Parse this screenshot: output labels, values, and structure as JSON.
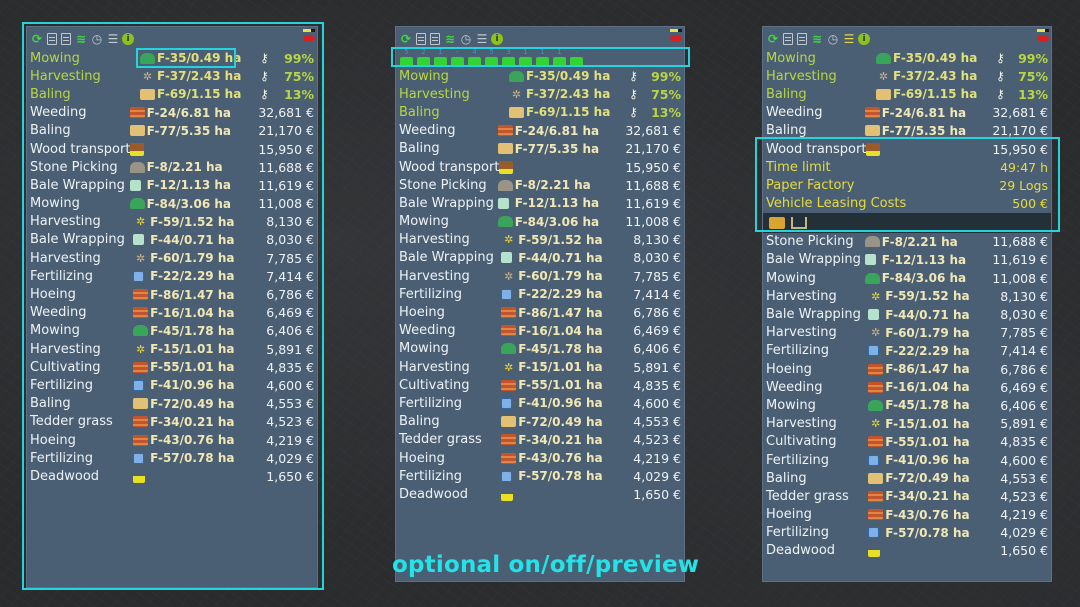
{
  "caption": "optional on/off/preview",
  "toolbar_icons": [
    "refresh-icon",
    "list-icon",
    "contract-icon",
    "field-icon",
    "clock-icon",
    "clear-filter-icon",
    "info-icon"
  ],
  "toolbar_right_icons": [
    "progress-bar-icon",
    "eye-icon"
  ],
  "colors": {
    "highlight": "#24d3dc",
    "active_text": "#b8d640",
    "detail_text": "#e7db3c",
    "panel_bg": "#4b5f74"
  },
  "vehicle_filter": [
    {
      "icon": "tractor-icon",
      "count": "5"
    },
    {
      "icon": "loader-icon",
      "count": "2"
    },
    {
      "icon": "trailer-icon",
      "count": "1"
    },
    {
      "icon": "harvester-icon",
      "count": "-"
    },
    {
      "icon": "mower-icon",
      "count": "4"
    },
    {
      "icon": "sprayer-icon",
      "count": "5"
    },
    {
      "icon": "cultivator-icon",
      "count": "3"
    },
    {
      "icon": "baler-icon",
      "count": "1"
    },
    {
      "icon": "chainsaw-icon",
      "count": "1"
    },
    {
      "icon": "weeder-icon",
      "count": "1"
    },
    {
      "icon": "seeder-icon",
      "count": "-"
    }
  ],
  "active_jobs": [
    {
      "name": "Mowing",
      "icon": "mowing-icon",
      "field": "F-35/0.49 ha",
      "progress": "99%"
    },
    {
      "name": "Harvesting",
      "icon": "harvesting-icon",
      "field": "F-37/2.43 ha",
      "progress": "75%"
    },
    {
      "name": "Baling",
      "icon": "baling-icon",
      "field": "F-69/1.15 ha",
      "progress": "13%"
    }
  ],
  "jobs": [
    {
      "name": "Weeding",
      "icon": "weeding-icon",
      "field": "F-24/6.81 ha",
      "reward": "32,681 €"
    },
    {
      "name": "Baling",
      "icon": "baling-icon",
      "field": "F-77/5.35 ha",
      "reward": "21,170 €"
    },
    {
      "name": "Wood transport",
      "icon": "wood-icon",
      "field": "",
      "reward": "15,950 €"
    },
    {
      "name": "Stone Picking",
      "icon": "stone-icon",
      "field": "F-8/2.21 ha",
      "reward": "11,688 €"
    },
    {
      "name": "Bale Wrapping",
      "icon": "wrap-icon",
      "field": "F-12/1.13 ha",
      "reward": "11,619 €"
    },
    {
      "name": "Mowing",
      "icon": "mowing-icon",
      "field": "F-84/3.06 ha",
      "reward": "11,008 €"
    },
    {
      "name": "Harvesting",
      "icon": "harvesting-yellow-icon",
      "field": "F-59/1.52 ha",
      "reward": "8,130 €"
    },
    {
      "name": "Bale Wrapping",
      "icon": "wrap-icon",
      "field": "F-44/0.71 ha",
      "reward": "8,030 €"
    },
    {
      "name": "Harvesting",
      "icon": "harvesting-icon",
      "field": "F-60/1.79 ha",
      "reward": "7,785 €"
    },
    {
      "name": "Fertilizing",
      "icon": "fertilizing-icon",
      "field": "F-22/2.29 ha",
      "reward": "7,414 €"
    },
    {
      "name": "Hoeing",
      "icon": "hoeing-icon",
      "field": "F-86/1.47 ha",
      "reward": "6,786 €"
    },
    {
      "name": "Weeding",
      "icon": "weeding-icon",
      "field": "F-16/1.04 ha",
      "reward": "6,469 €"
    },
    {
      "name": "Mowing",
      "icon": "mowing-icon",
      "field": "F-45/1.78 ha",
      "reward": "6,406 €"
    },
    {
      "name": "Harvesting",
      "icon": "harvesting-yellow-icon",
      "field": "F-15/1.01 ha",
      "reward": "5,891 €"
    },
    {
      "name": "Cultivating",
      "icon": "cultivating-icon",
      "field": "F-55/1.01 ha",
      "reward": "4,835 €"
    },
    {
      "name": "Fertilizing",
      "icon": "fertilizing-icon",
      "field": "F-41/0.96 ha",
      "reward": "4,600 €"
    },
    {
      "name": "Baling",
      "icon": "baling-icon",
      "field": "F-72/0.49 ha",
      "reward": "4,553 €"
    },
    {
      "name": "Tedder grass",
      "icon": "tedder-icon",
      "field": "F-34/0.21 ha",
      "reward": "4,523 €"
    },
    {
      "name": "Hoeing",
      "icon": "hoeing-icon",
      "field": "F-43/0.76 ha",
      "reward": "4,219 €"
    },
    {
      "name": "Fertilizing",
      "icon": "fertilizing-icon",
      "field": "F-57/0.78 ha",
      "reward": "4,029 €"
    },
    {
      "name": "Deadwood",
      "icon": "deadwood-icon",
      "field": "",
      "reward": "1,650 €"
    }
  ],
  "wood_detail": [
    {
      "label": "Time limit",
      "value": "49:47 h"
    },
    {
      "label": "Paper Factory",
      "value": "29 Logs"
    },
    {
      "label": "Vehicle Leasing Costs",
      "value": "500 €"
    }
  ],
  "wood_vehicles": [
    "truck-icon",
    "log-trailer-icon"
  ]
}
